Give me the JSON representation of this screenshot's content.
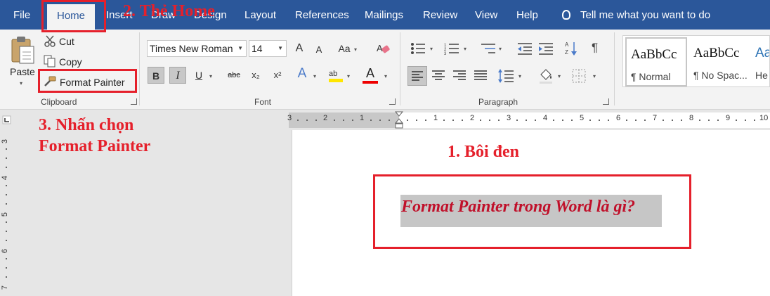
{
  "tabs": [
    {
      "label": "File",
      "active": false
    },
    {
      "label": "Home",
      "active": true
    },
    {
      "label": "Insert",
      "active": false
    },
    {
      "label": "Draw",
      "active": false
    },
    {
      "label": "Design",
      "active": false
    },
    {
      "label": "Layout",
      "active": false
    },
    {
      "label": "References",
      "active": false
    },
    {
      "label": "Mailings",
      "active": false
    },
    {
      "label": "Review",
      "active": false
    },
    {
      "label": "View",
      "active": false
    },
    {
      "label": "Help",
      "active": false
    }
  ],
  "tell_me": "Tell me what you want to do",
  "clipboard": {
    "paste": "Paste",
    "cut": "Cut",
    "copy": "Copy",
    "format_painter": "Format Painter",
    "group_label": "Clipboard"
  },
  "font": {
    "family": "Times New Roman",
    "size": "14",
    "grow": "A",
    "shrink": "A",
    "change_case": "Aa",
    "bold": "B",
    "italic": "I",
    "underline": "U",
    "strikethrough": "abc",
    "subscript": "x₂",
    "superscript": "x²",
    "text_effects": "A",
    "font_color": "A",
    "group_label": "Font"
  },
  "paragraph": {
    "group_label": "Paragraph"
  },
  "styles": [
    {
      "sample": "AaBbCc",
      "name": "¶ Normal",
      "selected": true
    },
    {
      "sample": "AaBbCc",
      "name": "¶ No Spac...",
      "selected": false
    },
    {
      "sample": "Aa",
      "name": "He",
      "selected": false
    }
  ],
  "ruler": {
    "h_margin_ticks": [
      "3",
      "2",
      "1"
    ],
    "h_ticks": [
      "1",
      "2",
      "3",
      "4",
      "5",
      "6",
      "7",
      "8",
      "9",
      "10"
    ],
    "v_ticks": [
      "3",
      "4",
      "5",
      "6",
      "7"
    ]
  },
  "annotations": {
    "step1": "1. Bôi đen",
    "step2": "2. Thẻ Home",
    "step3_line1": "3. Nhấn chọn",
    "step3_line2": "Format Painter"
  },
  "document": {
    "selected_text": "Format Painter trong Word là gì?"
  },
  "colors": {
    "ribbon_tab_bg": "#2b579a",
    "annotation_red": "#e5202b",
    "doc_text_color": "#c0102a",
    "selection_gray": "#c6c6c6"
  }
}
